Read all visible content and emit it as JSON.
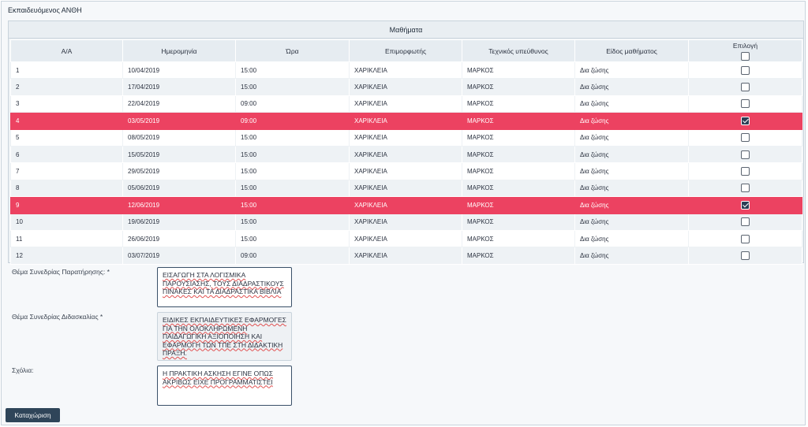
{
  "panel": {
    "title": "Εκπαιδευόμενος ΑΝΘΗ"
  },
  "table": {
    "caption": "Μαθήματα",
    "headers": [
      "Α/Α",
      "Ημερομηνία",
      "Ώρα",
      "Επιμορφωτής",
      "Τεχνικός υπεύθυνος",
      "Είδος μαθήματος",
      "Επιλογή"
    ],
    "rows": [
      {
        "aa": "1",
        "date": "10/04/2019",
        "time": "15:00",
        "trainer": "ΧΑΡΙΚΛΕΙΑ",
        "tech": "ΜΑΡΚΟΣ",
        "type": "Δια ζώσης",
        "selected": false
      },
      {
        "aa": "2",
        "date": "17/04/2019",
        "time": "15:00",
        "trainer": "ΧΑΡΙΚΛΕΙΑ",
        "tech": "ΜΑΡΚΟΣ",
        "type": "Δια ζώσης",
        "selected": false
      },
      {
        "aa": "3",
        "date": "22/04/2019",
        "time": "09:00",
        "trainer": "ΧΑΡΙΚΛΕΙΑ",
        "tech": "ΜΑΡΚΟΣ",
        "type": "Δια ζώσης",
        "selected": false
      },
      {
        "aa": "4",
        "date": "03/05/2019",
        "time": "09:00",
        "trainer": "ΧΑΡΙΚΛΕΙΑ",
        "tech": "ΜΑΡΚΟΣ",
        "type": "Δια ζώσης",
        "selected": true
      },
      {
        "aa": "5",
        "date": "08/05/2019",
        "time": "15:00",
        "trainer": "ΧΑΡΙΚΛΕΙΑ",
        "tech": "ΜΑΡΚΟΣ",
        "type": "Δια ζώσης",
        "selected": false
      },
      {
        "aa": "6",
        "date": "15/05/2019",
        "time": "15:00",
        "trainer": "ΧΑΡΙΚΛΕΙΑ",
        "tech": "ΜΑΡΚΟΣ",
        "type": "Δια ζώσης",
        "selected": false
      },
      {
        "aa": "7",
        "date": "29/05/2019",
        "time": "15:00",
        "trainer": "ΧΑΡΙΚΛΕΙΑ",
        "tech": "ΜΑΡΚΟΣ",
        "type": "Δια ζώσης",
        "selected": false
      },
      {
        "aa": "8",
        "date": "05/06/2019",
        "time": "15:00",
        "trainer": "ΧΑΡΙΚΛΕΙΑ",
        "tech": "ΜΑΡΚΟΣ",
        "type": "Δια ζώσης",
        "selected": false
      },
      {
        "aa": "9",
        "date": "12/06/2019",
        "time": "15:00",
        "trainer": "ΧΑΡΙΚΛΕΙΑ",
        "tech": "ΜΑΡΚΟΣ",
        "type": "Δια ζώσης",
        "selected": true
      },
      {
        "aa": "10",
        "date": "19/06/2019",
        "time": "15:00",
        "trainer": "ΧΑΡΙΚΛΕΙΑ",
        "tech": "ΜΑΡΚΟΣ",
        "type": "Δια ζώσης",
        "selected": false
      },
      {
        "aa": "11",
        "date": "26/06/2019",
        "time": "15:00",
        "trainer": "ΧΑΡΙΚΛΕΙΑ",
        "tech": "ΜΑΡΚΟΣ",
        "type": "Δια ζώσης",
        "selected": false
      },
      {
        "aa": "12",
        "date": "03/07/2019",
        "time": "09:00",
        "trainer": "ΧΑΡΙΚΛΕΙΑ",
        "tech": "ΜΑΡΚΟΣ",
        "type": "Δια ζώσης",
        "selected": false
      }
    ]
  },
  "form": {
    "observation_label": "Θέμα Συνεδρίας Παρατήρησης:  *",
    "observation_value": "ΕΙΣΑΓΩΓΗ ΣΤΑ ΛΟΓΙΣΜΙΚΑ ΠΑΡΟΥΣΙΑΣΗΣ, ΤΟΥΣ ΔΙΑΔΡΑΣΤΙΚΟΥΣ ΠΙΝΑΚΕΣ ΚΑΙ ΤΑ ΔΙΑΔΡΑΣΤΙΚΑ ΒΙΒΛΙΑ",
    "teaching_label": "Θέμα Συνεδρίας Διδασκαλίας  *",
    "teaching_value": "ΕΙΔΙΚΕΣ ΕΚΠΑΙΔΕΥΤΙΚΕΣ ΕΦΑΡΜΟΓΕΣ ΓΙΑ ΤΗΝ ΟΛΟΚΛΗΡΩΜΕΝΗ ΠΑΙΔΑΓΩΓΙΚΗ ΑΞΙΟΠΟΙΗΣΗ ΚΑΙ ΕΦΑΡΜΟΓΗ ΤΩΝ ΤΠΕ ΣΤΗ ΔΙΔΑΚΤΙΚΗ ΠΡΑΞΗ.",
    "comments_label": "Σχόλια:",
    "comments_value": "Η ΠΡΑΚΤΙΚΗ ΑΣΚΗΣΗ ΕΓΙΝΕ ΟΠΩΣ ΑΚΡΙΒΩΣ ΕΙΧΕ ΠΡΟΓΡΑΜΜΑΤΙΣΤΕΙ",
    "submit_label": "Καταχώριση"
  },
  "colors": {
    "selected_row": "#ec4261",
    "button": "#2f4559"
  }
}
